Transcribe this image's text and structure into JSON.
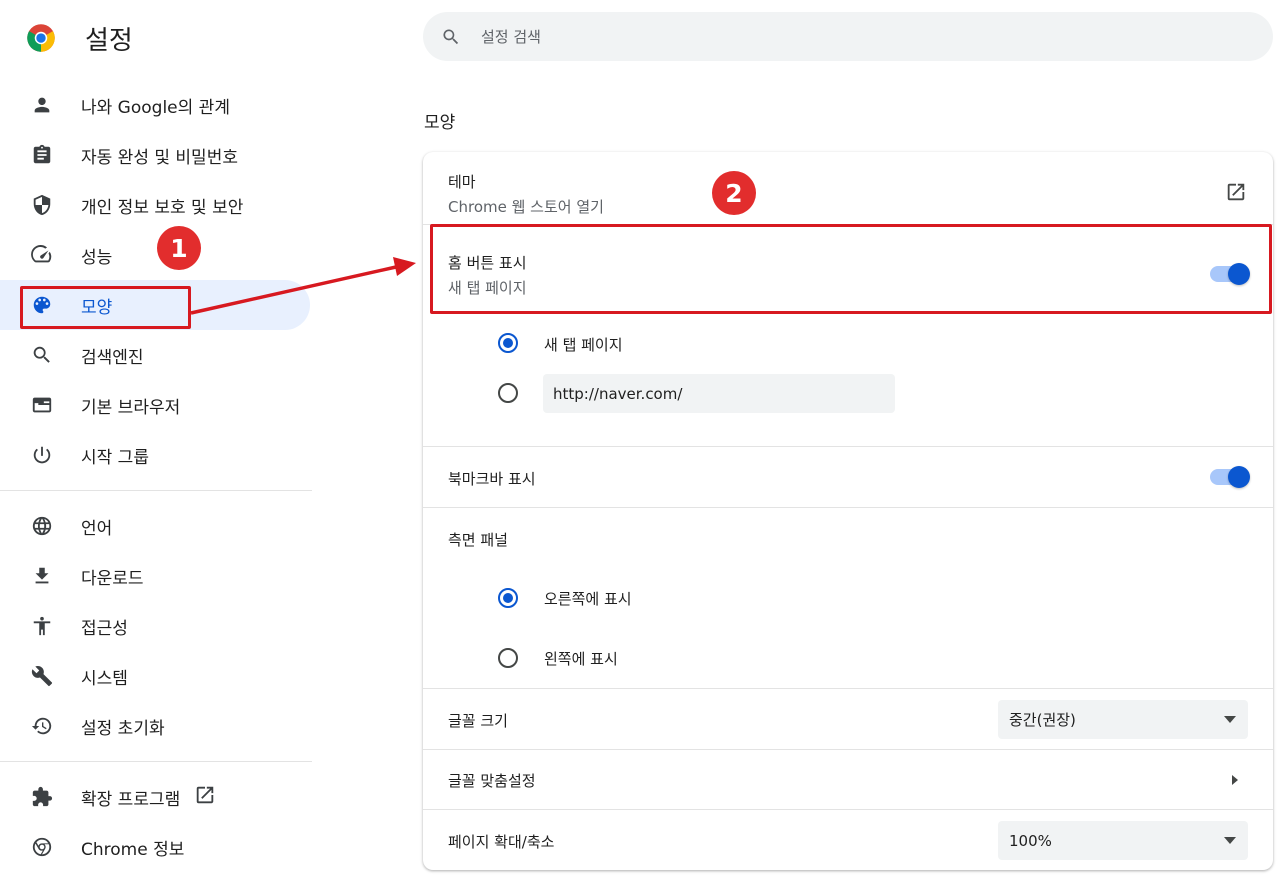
{
  "header": {
    "title": "설정",
    "logo_icon": "chrome-logo-icon"
  },
  "search": {
    "placeholder": "설정 검색",
    "icon": "search-icon"
  },
  "sidebar": {
    "items": [
      {
        "label": "나와 Google의 관계",
        "icon": "person-icon"
      },
      {
        "label": "자동 완성 및 비밀번호",
        "icon": "clipboard-icon"
      },
      {
        "label": "개인 정보 보호 및 보안",
        "icon": "shield-icon"
      },
      {
        "label": "성능",
        "icon": "speedometer-icon"
      },
      {
        "label": "모양",
        "icon": "palette-icon",
        "active": true
      },
      {
        "label": "검색엔진",
        "icon": "search-icon"
      },
      {
        "label": "기본 브라우저",
        "icon": "browser-window-icon"
      },
      {
        "label": "시작 그룹",
        "icon": "power-icon"
      }
    ],
    "items2": [
      {
        "label": "언어",
        "icon": "globe-icon"
      },
      {
        "label": "다운로드",
        "icon": "download-icon"
      },
      {
        "label": "접근성",
        "icon": "accessibility-icon"
      },
      {
        "label": "시스템",
        "icon": "wrench-icon"
      },
      {
        "label": "설정 초기화",
        "icon": "restore-icon"
      }
    ],
    "items3": [
      {
        "label": "확장 프로그램",
        "icon": "puzzle-icon",
        "external_icon": "open-in-new-icon"
      },
      {
        "label": "Chrome 정보",
        "icon": "chrome-icon"
      }
    ]
  },
  "main": {
    "section_title": "모양",
    "theme": {
      "title": "테마",
      "subtitle": "Chrome 웹 스토어 열기",
      "icon": "open-in-new-icon"
    },
    "home_button": {
      "title": "홈 버튼 표시",
      "subtitle": "새 탭 페이지",
      "enabled": true
    },
    "home_options": {
      "option1": "새 탭 페이지",
      "option2_value": "http://naver.com/",
      "selected": "option1"
    },
    "bookmarks_bar": {
      "title": "북마크바 표시",
      "enabled": true
    },
    "side_panel": {
      "title": "측면 패널",
      "option_right": "오른쪽에 표시",
      "option_left": "왼쪽에 표시",
      "selected": "right"
    },
    "font_size": {
      "title": "글꼴 크기",
      "value": "중간(권장)"
    },
    "customize_fonts": {
      "title": "글꼴 맞춤설정"
    },
    "page_zoom": {
      "title": "페이지 확대/축소",
      "value": "100%"
    }
  },
  "annotations": {
    "badge1": "1",
    "badge2": "2",
    "color": "#d71920"
  },
  "colors": {
    "accent": "#0b57d0",
    "accent_light": "#e8f0fe",
    "toggle_track": "#a8c7fa",
    "annotation_red": "#d71920"
  }
}
